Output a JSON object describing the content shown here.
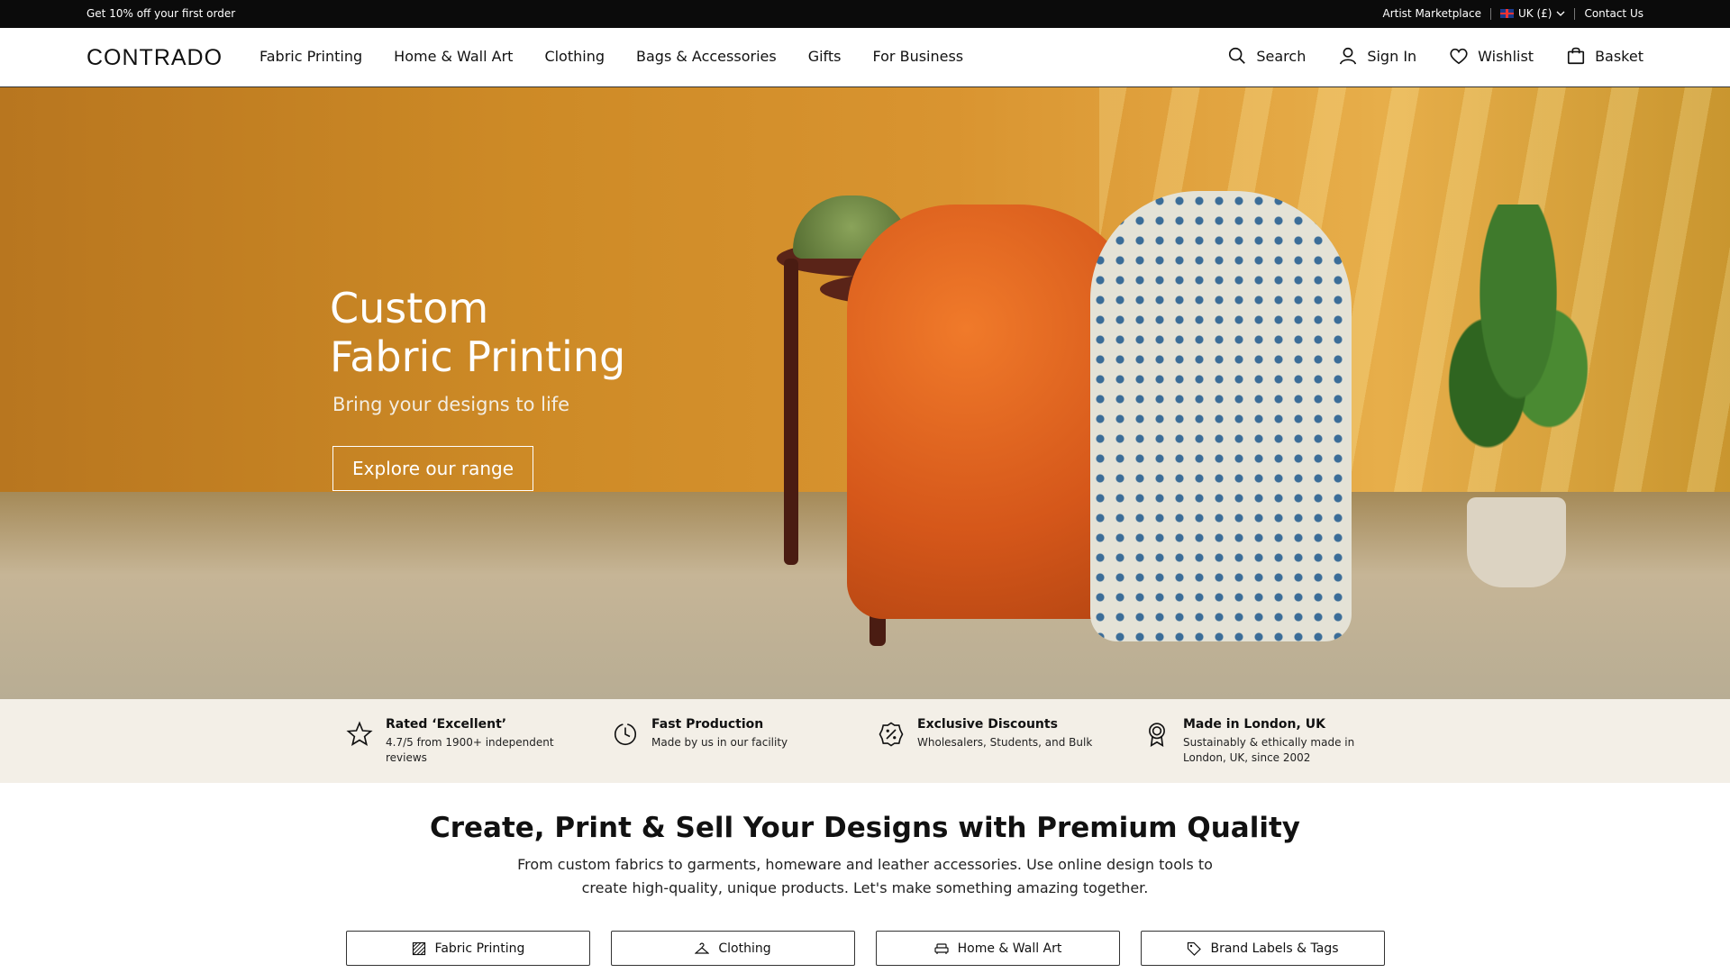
{
  "topbar": {
    "promo": "Get 10% off your first order",
    "artist_marketplace": "Artist Marketplace",
    "region": "UK (£)",
    "contact": "Contact Us"
  },
  "header": {
    "logo": "CONTRADO",
    "nav": [
      "Fabric Printing",
      "Home & Wall Art",
      "Clothing",
      "Bags & Accessories",
      "Gifts",
      "For Business"
    ],
    "search": "Search",
    "sign_in": "Sign In",
    "wishlist": "Wishlist",
    "basket": "Basket"
  },
  "hero": {
    "title_line1": "Custom",
    "title_line2": "Fabric Printing",
    "subtitle": "Bring your designs to life",
    "cta": "Explore our range"
  },
  "features": [
    {
      "title": "Rated ‘Excellent’",
      "desc": "4.7/5 from 1900+ independent reviews",
      "icon": "star-icon"
    },
    {
      "title": "Fast Production",
      "desc": "Made by us in our facility",
      "icon": "clock-icon"
    },
    {
      "title": "Exclusive Discounts",
      "desc": "Wholesalers, Students, and Bulk",
      "icon": "percent-badge-icon"
    },
    {
      "title": "Made in London, UK",
      "desc": "Sustainably & ethically made in London, UK, since 2002",
      "icon": "award-icon"
    }
  ],
  "intro": {
    "title": "Create, Print & Sell Your Designs with Premium Quality",
    "desc": "From custom fabrics to garments, homeware and leather accessories. Use online design tools to create high-quality, unique products. Let's make something amazing together."
  },
  "categories": [
    {
      "label": "Fabric Printing",
      "icon": "fabric-icon"
    },
    {
      "label": "Clothing",
      "icon": "hanger-icon"
    },
    {
      "label": "Home & Wall Art",
      "icon": "sofa-icon"
    },
    {
      "label": "Brand Labels & Tags",
      "icon": "tag-icon"
    }
  ]
}
